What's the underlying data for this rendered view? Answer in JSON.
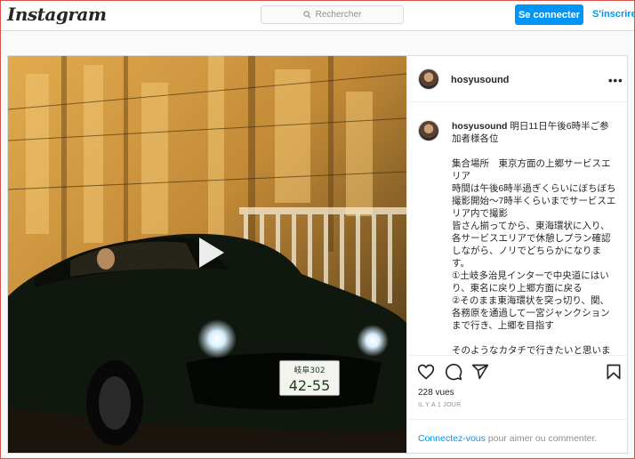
{
  "header": {
    "logo": "Instagram",
    "search_placeholder": "Rechercher",
    "login_label": "Se connecter",
    "signup_label": "S'inscrire"
  },
  "post": {
    "username": "hosyusound",
    "caption_user": "hosyusound",
    "caption_lines": [
      "明日11日午後6時半ご参加者様各位",
      "",
      "集合場所　東京方面の上郷サービスエリア",
      "時間は午後6時半過ぎくらいにぼちぼち撮影開始〜7時半くらいまでサービスエリア内で撮影",
      "皆さん揃ってから、東海環状に入り、各サービスエリアで休憩しプラン確認しながら、ノリでどちらかになります。",
      "①土岐多治見インターで中央道にはいり、東名に戻り上郷方面に戻る",
      "②そのまま東海環状を突っ切り、関、各務原を通過して一宮ジャンクションまで行き、上郷を目指す",
      "",
      "そのようなカタチで行きたいと思います"
    ],
    "views": "228 vues",
    "time": "IL Y A 1 JOUR",
    "footer_link": "Connectez-vous",
    "footer_text": " pour aimer ou commenter.",
    "plate_line1": "岐阜302",
    "plate_line2": "42-55"
  },
  "icons": [
    "search-icon",
    "play-icon",
    "more-icon",
    "heart-icon",
    "comment-icon",
    "share-icon",
    "bookmark-icon"
  ],
  "colors": {
    "accent": "#0095f6",
    "frame": "#d9534f"
  }
}
